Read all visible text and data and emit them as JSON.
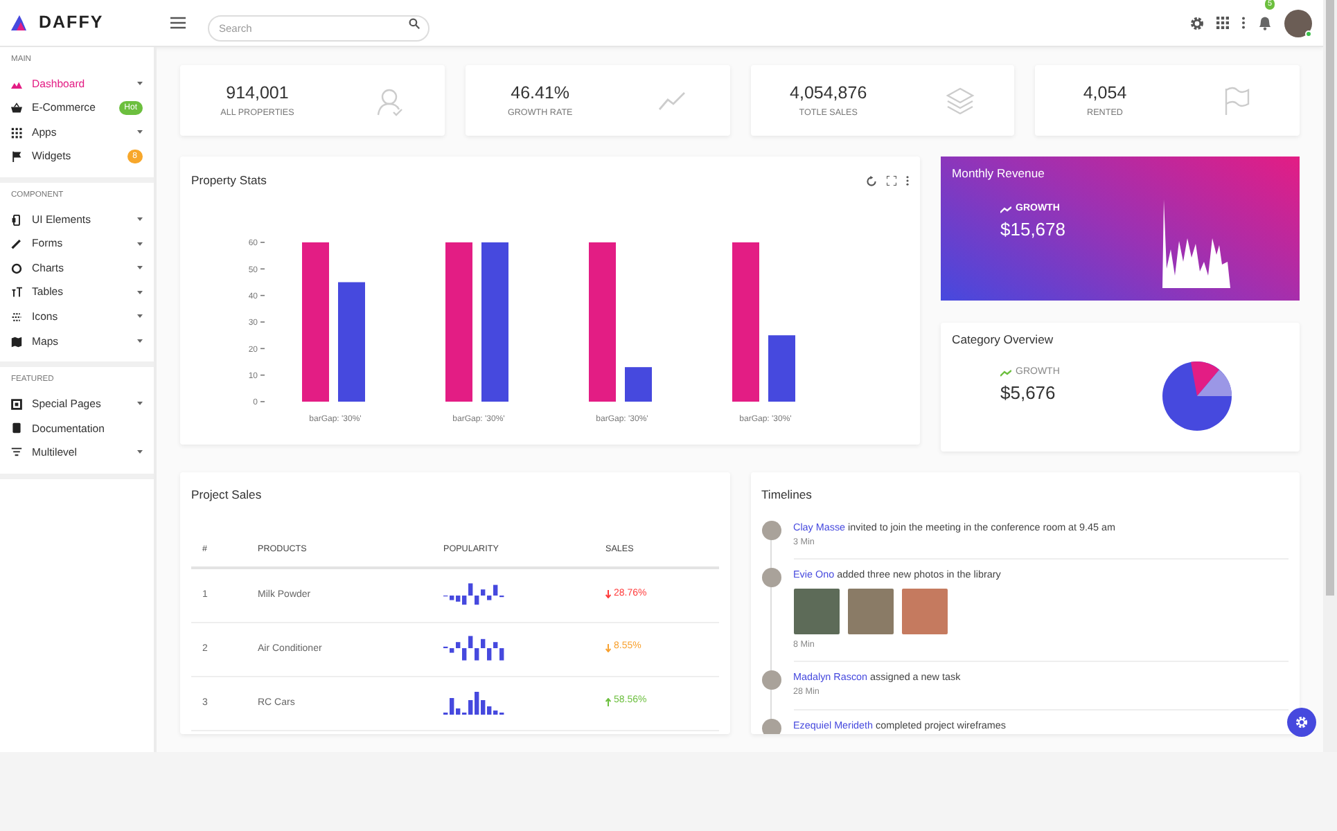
{
  "header": {
    "logo": "DAFFY",
    "search": {
      "placeholder": "Search"
    },
    "notifications": "5",
    "user_online": true
  },
  "sidebar": {
    "sections": [
      {
        "title": "MAIN",
        "items": [
          {
            "label": "Dashboard",
            "selected": true,
            "submenu": true
          },
          {
            "label": "E-Commerce",
            "selected": false,
            "submenu": false,
            "badge": {
              "text": "Hot",
              "color": "#6cbf3e"
            }
          },
          {
            "label": "Apps",
            "selected": false,
            "submenu": true
          },
          {
            "label": "Widgets",
            "selected": false,
            "submenu": false,
            "badge": {
              "text": "8",
              "color": "#f7a72b"
            }
          }
        ]
      },
      {
        "title": "COMPONENT",
        "items": [
          {
            "label": "UI Elements",
            "selected": false,
            "submenu": true
          },
          {
            "label": "Forms",
            "selected": false,
            "submenu": true
          },
          {
            "label": "Charts",
            "selected": false,
            "submenu": true
          },
          {
            "label": "Tables",
            "selected": false,
            "submenu": true
          },
          {
            "label": "Icons",
            "selected": false,
            "submenu": true
          },
          {
            "label": "Maps",
            "selected": false,
            "submenu": true
          }
        ]
      },
      {
        "title": "FEATURED",
        "items": [
          {
            "label": "Special Pages",
            "selected": false,
            "submenu": true
          },
          {
            "label": "Documentation",
            "selected": false,
            "submenu": false
          },
          {
            "label": "Multilevel",
            "selected": false,
            "submenu": true
          }
        ]
      }
    ]
  },
  "stats": [
    {
      "value": "914,001",
      "label": "ALL PROPERTIES"
    },
    {
      "value": "46.41%",
      "label": "GROWTH RATE"
    },
    {
      "value": "4,054,876",
      "label": "TOTLE SALES"
    },
    {
      "value": "4,054",
      "label": "RENTED"
    }
  ],
  "property_stats": {
    "title": "Property Stats",
    "chart_data": {
      "type": "bar",
      "categories": [
        "barGap: '30%'",
        "barGap: '30%'",
        "barGap: '30%'",
        "barGap: '30%'"
      ],
      "series": [
        {
          "color": "#e31d84",
          "values": [
            60,
            60,
            60,
            60
          ]
        },
        {
          "color": "#4649de",
          "values": [
            45,
            60,
            13,
            25
          ]
        }
      ],
      "ylim": [
        0,
        60
      ],
      "yticks": [
        0,
        10,
        20,
        30,
        40,
        50,
        60
      ]
    }
  },
  "monthly_revenue": {
    "title": "Monthly Revenue",
    "growth_label": "GROWTH",
    "value": "$15,678"
  },
  "category_overview": {
    "title": "Category Overview",
    "growth_label": "GROWTH",
    "value": "$5,676"
  },
  "project_sales": {
    "title": "Project Sales",
    "columns": [
      "#",
      "PRODUCTS",
      "POPULARITY",
      "SALES"
    ],
    "rows": [
      {
        "index": "1",
        "product": "Milk Powder",
        "sales": "28.76%",
        "rising": false,
        "color": "#ff3b3b"
      },
      {
        "index": "2",
        "product": "Air Conditioner",
        "sales": "8.55%",
        "rising": false,
        "color": "#f8a12f"
      },
      {
        "index": "3",
        "product": "RC Cars",
        "sales": "58.56%",
        "rising": true,
        "color": "#6cbf3e"
      }
    ]
  },
  "timeline": {
    "title": "Timelines",
    "items": [
      {
        "name": "Clay Masse",
        "text": "invited to join the meeting in the conference room at 9.45 am",
        "time": "3 Min",
        "photos": false
      },
      {
        "name": "Evie Ono",
        "text": "added three new photos in the library",
        "time": "8 Min",
        "photos": true
      },
      {
        "name": "Madalyn Rascon",
        "text": "assigned a new task",
        "time": "28 Min",
        "photos": false
      },
      {
        "name": "Ezequiel Merideth",
        "text": "completed project wireframes",
        "photos": false
      }
    ]
  }
}
